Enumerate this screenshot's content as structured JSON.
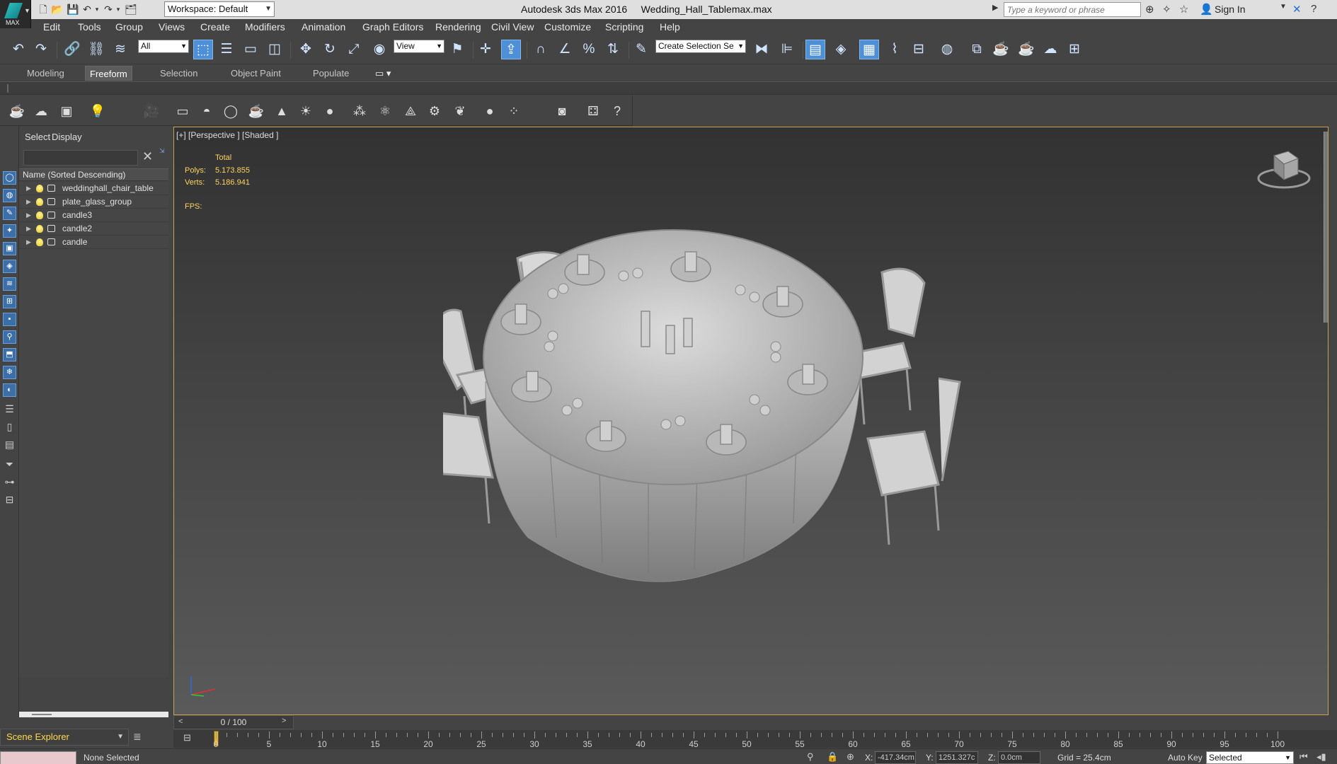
{
  "app": {
    "logo_text": "MAX",
    "title": "Autodesk 3ds Max 2016     Wedding_Hall_Tablemax.max",
    "workspace": "Workspace: Default",
    "search_placeholder": "Type a keyword or phrase",
    "sign_in": "Sign In"
  },
  "menu": [
    "Edit",
    "Tools",
    "Group",
    "Views",
    "Create",
    "Modifiers",
    "Animation",
    "Graph Editors",
    "Rendering",
    "Civil View",
    "Customize",
    "Scripting",
    "Help"
  ],
  "toolbar": {
    "filter_select": "All",
    "coord_select": "View",
    "selection_set": "Create Selection Se"
  },
  "ribbon_tabs": [
    "Modeling",
    "Freeform",
    "Selection",
    "Object Paint",
    "Populate"
  ],
  "ribbon_active": "Freeform",
  "scene_explorer": {
    "tabs": [
      "Select",
      "Display"
    ],
    "column_header": "Name (Sorted Descending)",
    "items": [
      "weddinghall_chair_table",
      "plate_glass_group",
      "candle3",
      "candle2",
      "candle"
    ],
    "footer_label": "Scene Explorer"
  },
  "viewport": {
    "label": "[+] [Perspective ] [Shaded ]",
    "stats_header": "Total",
    "polys_label": "Polys:",
    "polys_value": "5.173.855",
    "verts_label": "Verts:",
    "verts_value": "5.186.941",
    "fps_label": "FPS:"
  },
  "timeline": {
    "frame_display": "0 / 100",
    "ticks": [
      "0",
      "5",
      "10",
      "15",
      "20",
      "25",
      "30",
      "35",
      "40",
      "45",
      "50",
      "55",
      "60",
      "65",
      "70",
      "75",
      "80",
      "85",
      "90",
      "95",
      "100"
    ]
  },
  "status": {
    "selection": "None Selected",
    "x_label": "X:",
    "x_value": "-417.34cm",
    "y_label": "Y:",
    "y_value": "1251.327c",
    "z_label": "Z:",
    "z_value": "0.0cm",
    "grid": "Grid = 25.4cm",
    "auto_key": "Auto Key",
    "key_mode": "Selected"
  },
  "colors": {
    "accent_blue": "#4e90d8",
    "viewport_border": "#c9a24b",
    "stats_yellow": "#ffd45e",
    "scene_explorer_label": "#ffd84a"
  }
}
